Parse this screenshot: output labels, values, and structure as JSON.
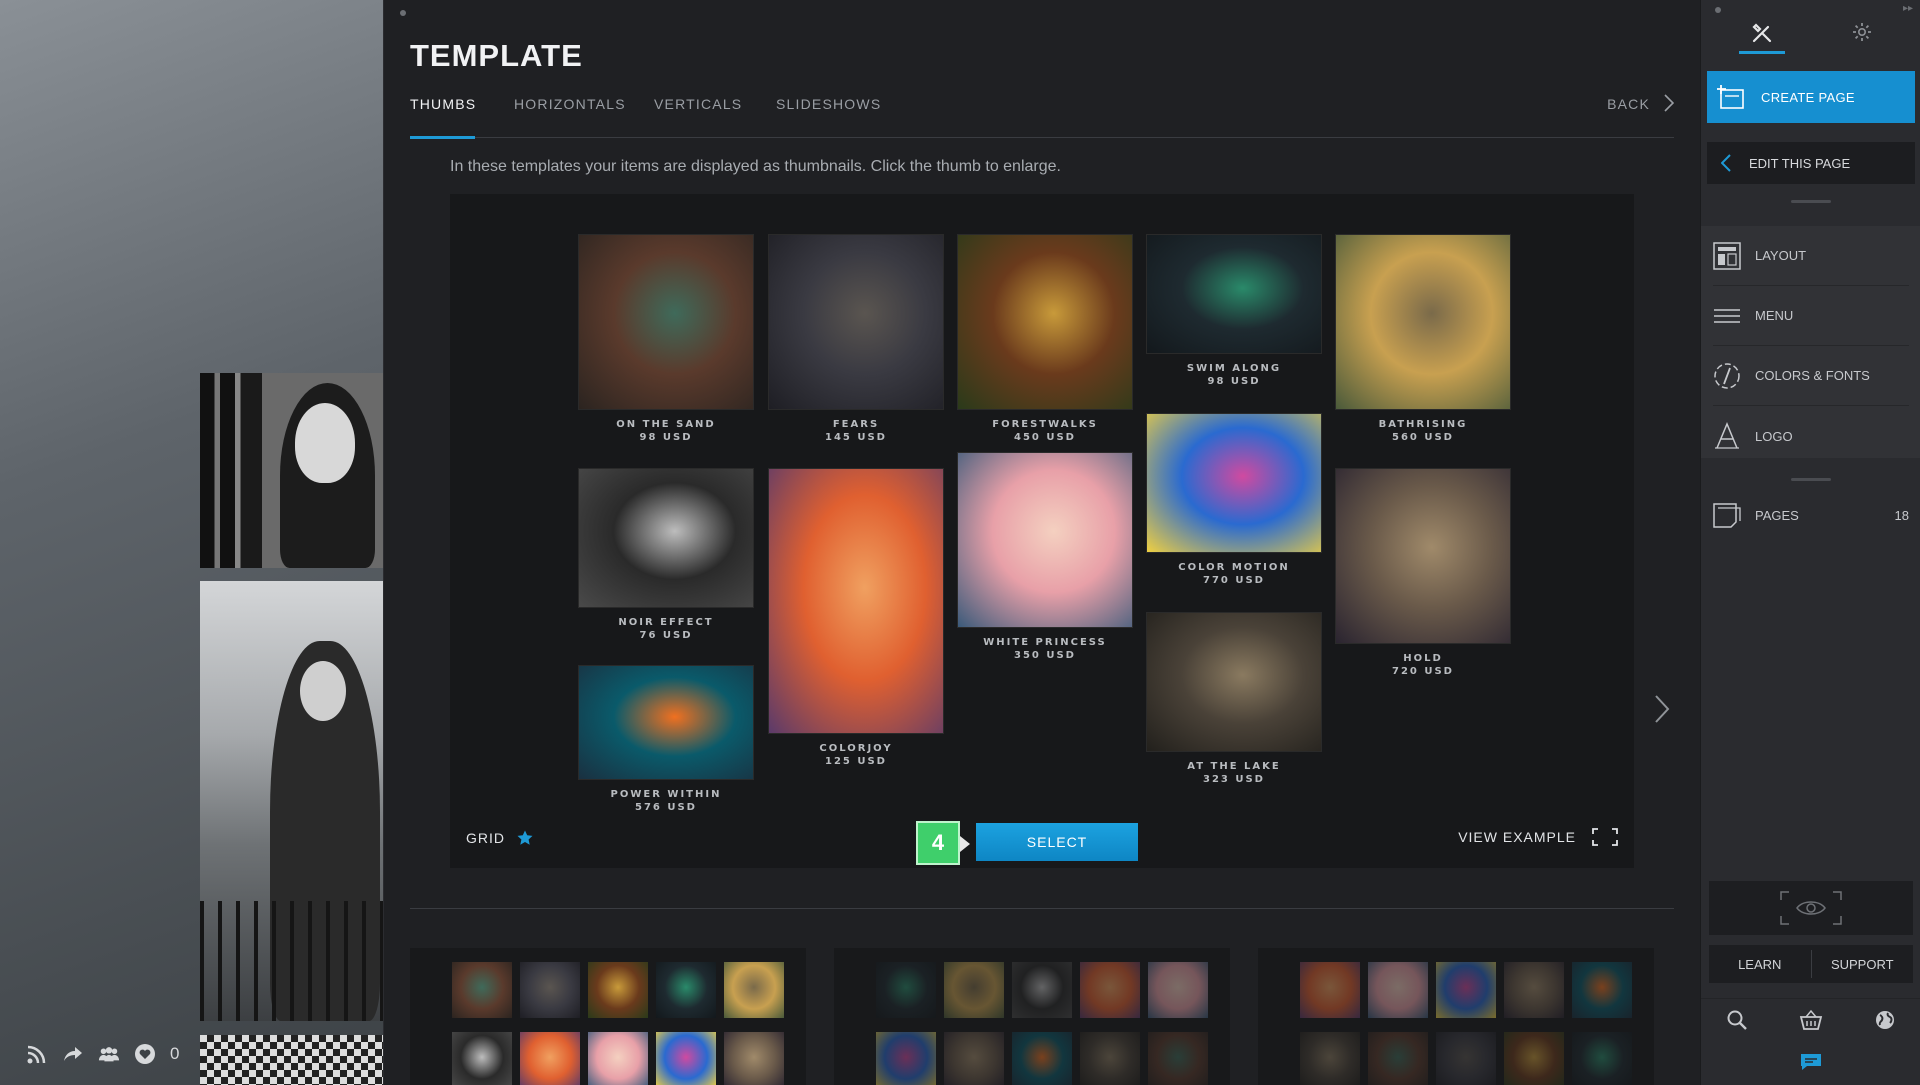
{
  "template": {
    "title": "TEMPLATE",
    "tabs": [
      {
        "label": "THUMBS",
        "active": true
      },
      {
        "label": "HORIZONTALS",
        "active": false
      },
      {
        "label": "VERTICALS",
        "active": false
      },
      {
        "label": "SLIDESHOWS",
        "active": false
      }
    ],
    "back_label": "BACK",
    "description": "In these templates your items are displayed as thumbnails. Click the thumb to enlarge.",
    "thumbs": [
      {
        "name": "ON THE SAND",
        "price": "98 USD",
        "colors": [
          "#5a3a2c",
          "#3f6a5a",
          "#2b2420"
        ]
      },
      {
        "name": "FEARS",
        "price": "145 USD",
        "colors": [
          "#3a3a42",
          "#5a5550",
          "#1e1e24"
        ]
      },
      {
        "name": "FORESTWALKS",
        "price": "450 USD",
        "colors": [
          "#6a3a1c",
          "#c89a3a",
          "#2a3a1a"
        ]
      },
      {
        "name": "SWIM ALONG",
        "price": "98 USD",
        "colors": [
          "#1e2a30",
          "#2a8a6a",
          "#13181c"
        ]
      },
      {
        "name": "BATHRISING",
        "price": "560 USD",
        "colors": [
          "#c8a050",
          "#7a6a4a",
          "#4a5a3a"
        ]
      },
      {
        "name": "NOIR EFFECT",
        "price": "76 USD",
        "colors": [
          "#2a2a2a",
          "#bdbdbd",
          "#4a4a4a"
        ]
      },
      {
        "name": "COLORJOY",
        "price": "125 USD",
        "colors": [
          "#e06030",
          "#f0a060",
          "#5a3a6a"
        ]
      },
      {
        "name": "WHITE PRINCESS",
        "price": "350 USD",
        "colors": [
          "#e8a0a8",
          "#f4d0c0",
          "#3a5a7a"
        ]
      },
      {
        "name": "COLOR MOTION",
        "price": "770 USD",
        "colors": [
          "#2a6ad0",
          "#d04aa0",
          "#f0d040"
        ]
      },
      {
        "name": "HOLD",
        "price": "720 USD",
        "colors": [
          "#6a5a4a",
          "#a08a6a",
          "#2a2430"
        ]
      },
      {
        "name": "POWER WITHIN",
        "price": "576 USD",
        "colors": [
          "#0a5a6a",
          "#f07020",
          "#1a3040"
        ]
      },
      {
        "name": "AT THE LAKE",
        "price": "323 USD",
        "colors": [
          "#4a4238",
          "#8a7a60",
          "#22201c"
        ]
      }
    ],
    "grid_label": "GRID",
    "step_number": "4",
    "select_label": "SELECT",
    "view_example_label": "VIEW EXAMPLE"
  },
  "social": {
    "like_count": "0"
  },
  "sidebar": {
    "create_page": "CREATE PAGE",
    "edit_page": "EDIT THIS PAGE",
    "items": [
      {
        "label": "LAYOUT",
        "icon": "layout-icon"
      },
      {
        "label": "MENU",
        "icon": "menu-icon"
      },
      {
        "label": "COLORS & FONTS",
        "icon": "colors-fonts-icon"
      },
      {
        "label": "LOGO",
        "icon": "logo-icon"
      }
    ],
    "pages_label": "PAGES",
    "pages_count": "18",
    "learn_label": "LEARN",
    "support_label": "SUPPORT"
  },
  "colors": {
    "accent": "#1e9ad6",
    "step_badge": "#3fcf6b",
    "panel_bg": "#1f2023"
  }
}
